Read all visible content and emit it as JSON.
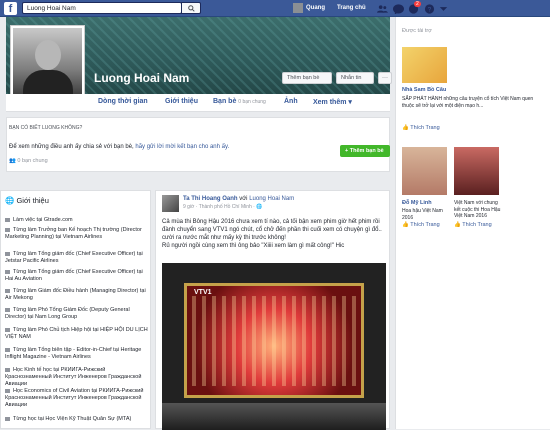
{
  "topbar": {
    "logo": "f",
    "search_value": "Luong Hoai Nam",
    "user_name": "Quang",
    "home_label": "Trang chủ",
    "notif_count": "2"
  },
  "profile": {
    "name": "Luong Hoai Nam",
    "add_friend": "Thêm bạn bè",
    "message": "Nhắn tin",
    "more": "···"
  },
  "tabs": [
    {
      "label": "Dòng thời gian"
    },
    {
      "label": "Giới thiệu"
    },
    {
      "label": "Bạn bè",
      "sub": "0 bạn chung"
    },
    {
      "label": "Ảnh"
    },
    {
      "label": "Xem thêm ▾"
    }
  ],
  "know": {
    "title": "Bạn có biết Luong Không?",
    "text_prefix": "Để xem những điều anh ấy chia sẻ với bạn bè,",
    "text_link": "hãy gửi lời mời kết bạn cho anh ấy.",
    "friends": "0 bạn chung",
    "add_button": "Thêm bạn bè"
  },
  "intro": {
    "title": "Giới thiệu",
    "items": [
      {
        "text": "Làm việc tại Gtrade.com"
      },
      {
        "text": "Từng làm Trưởng ban Kế hoạch Thị trường (Director Marketing Planning) tại Vietnam Airlines"
      },
      {
        "text": "Từng làm Tổng giám đốc (Chief Executive Officer) tại Jetstar Pacific Airlines"
      },
      {
        "text": "Từng làm Tổng giám đốc (Chief Executive Officer) tại Hai Au Aviation"
      },
      {
        "text": "Từng làm Giám đốc Điều hành (Managing Director) tại Air Mekong"
      },
      {
        "text": "Từng làm Phó Tổng Giám Đốc (Deputy General Director) tại Nam Long Group"
      },
      {
        "text": "Từng làm Phó Chủ tịch Hiệp hội tại HIỆP HỘI DU LỊCH VIỆT NAM"
      },
      {
        "text": "Từng làm Tổng biên tập - Editor-in-Chief tại Heritage Inflight Magazine - Vietnam Airlines"
      },
      {
        "text": "Học Kinh tế học tại РКИИГА-Рижский Краснознаменный Институт Инженеров Гражданской Авиации"
      },
      {
        "text": "Học Economics of Civil Aviation tại РКИИГА-Рижский Краснознаменный Институт Инженеров Гражданской Авиации"
      },
      {
        "text": "Từng học tại Học Viện Kỹ Thuật Quân Sự (MTA)"
      }
    ]
  },
  "post": {
    "author": "Ta Thi Hoang Oanh",
    "with_word": "với",
    "tagged": "Luong Hoai Nam",
    "meta": "9 giờ · Thành phố Hồ Chí Minh · 🌐",
    "text1": "Cả mùa thi Bông Hậu 2016 chưa xem tí nào, cả tối bận xem phim giờ hết phim rồi đành chuyển sang VTV1 ngó chút, cổ chở đến phần thi cuối xem có chuyện gì đổ.. cười ra nước mắt như mấy kỳ thi trước không!",
    "text2": "Rủ người ngồi cùng xem thì ông bảo \"Xiiii xem làm gì mất công!\" Hic",
    "image_label": "VTV1"
  },
  "sidebar": {
    "sponsored": "Được tài trợ",
    "ad1_title": "Nhà Sam Bồ Câu",
    "ad1_text": "SẮP PHÁT HÀNH những câu truyện cổ tích Việt Nam quen thuộc sẽ trở lại với một diện mạo h...",
    "ad1_like": "Thích Trang",
    "ad2_title": "Đỗ Mỹ Linh",
    "ad2_text": "Hoa hậu Việt Nam 2016",
    "ad2_like": "Thích Trang",
    "ad3_text": "Việt Nam với chung kết cuộc thi Hoa Hậu Việt Nam 2016",
    "ad3_like": "Thích Trang"
  },
  "colors": {
    "brand": "#3b5998",
    "link": "#365899",
    "green": "#42b72a"
  }
}
